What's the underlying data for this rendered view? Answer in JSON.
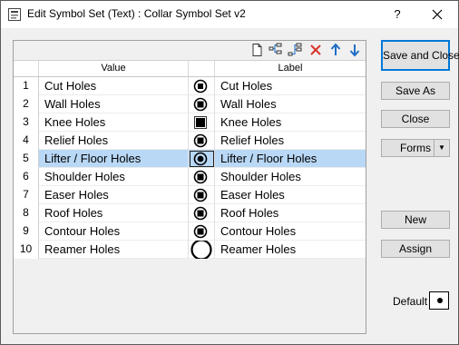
{
  "window": {
    "title": "Edit Symbol Set (Text) : Collar Symbol Set v2",
    "help_label": "?"
  },
  "grid": {
    "columns": [
      "Value",
      "Label"
    ],
    "rows": [
      {
        "num": "1",
        "value": "Cut Holes",
        "label": "Cut Holes",
        "symbol": "small-filled-square-in-circle"
      },
      {
        "num": "2",
        "value": "Wall Holes",
        "label": "Wall Holes",
        "symbol": "square-in-circle"
      },
      {
        "num": "3",
        "value": "Knee Holes",
        "label": "Knee Holes",
        "symbol": "filled-square"
      },
      {
        "num": "4",
        "value": "Relief Holes",
        "label": "Relief Holes",
        "symbol": "square-in-circle"
      },
      {
        "num": "5",
        "value": "Lifter / Floor Holes",
        "label": "Lifter / Floor Holes",
        "symbol": "dot-in-circle"
      },
      {
        "num": "6",
        "value": "Shoulder Holes",
        "label": "Shoulder Holes",
        "symbol": "square-in-circle"
      },
      {
        "num": "7",
        "value": "Easer Holes",
        "label": "Easer Holes",
        "symbol": "square-in-circle"
      },
      {
        "num": "8",
        "value": "Roof Holes",
        "label": "Roof Holes",
        "symbol": "square-in-circle"
      },
      {
        "num": "9",
        "value": "Contour Holes",
        "label": "Contour Holes",
        "symbol": "square-in-circle"
      },
      {
        "num": "10",
        "value": "Reamer Holes",
        "label": "Reamer Holes",
        "symbol": "large-open-circle"
      }
    ],
    "selected_row": 5
  },
  "buttons": {
    "save_close": "Save and Close",
    "save_as": "Save As",
    "close": "Close",
    "forms": "Forms",
    "new": "New",
    "assign": "Assign"
  },
  "default": {
    "label": "Default",
    "symbol": "dot"
  },
  "colors": {
    "selection": "#b9d8f6",
    "accent": "#0078d7",
    "delete_icon": "#d9342b",
    "arrow_icon": "#1f6fc5"
  }
}
